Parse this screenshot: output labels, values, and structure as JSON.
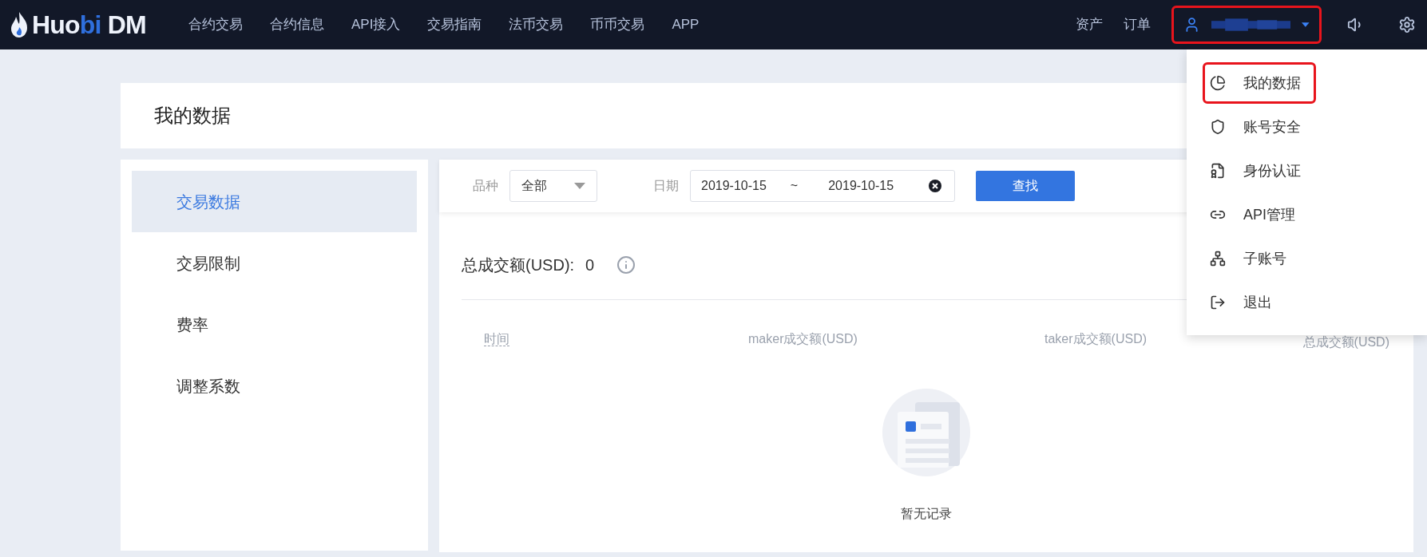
{
  "nav": {
    "logo": [
      {
        "text": "Huo",
        "accent": false
      },
      {
        "text": "bi",
        "accent": true
      },
      {
        "text": " DM",
        "accent": false
      }
    ],
    "links": [
      "合约交易",
      "合约信息",
      "API接入",
      "交易指南",
      "法币交易",
      "币币交易",
      "APP"
    ],
    "right_links": [
      "资产",
      "订单"
    ],
    "user": {
      "highlighted": true
    }
  },
  "page_title": "我的数据",
  "sidebar": {
    "items": [
      {
        "label": "交易数据",
        "selected": true
      },
      {
        "label": "交易限制",
        "selected": false
      },
      {
        "label": "费率",
        "selected": false
      },
      {
        "label": "调整系数",
        "selected": false
      }
    ]
  },
  "filters": {
    "variety_label": "品种",
    "variety_value": "全部",
    "date_label": "日期",
    "date_from": "2019-10-15",
    "date_sep": "~",
    "date_to": "2019-10-15",
    "search_button": "查找"
  },
  "summary": {
    "label": "总成交额(USD):",
    "value": "0"
  },
  "table": {
    "columns": [
      "时间",
      "maker成交额(USD)",
      "taker成交额(USD)",
      "总成交额(USD)"
    ],
    "empty_text": "暂无记录"
  },
  "user_menu": {
    "items": [
      {
        "label": "我的数据",
        "highlighted": true
      },
      {
        "label": "账号安全",
        "highlighted": false
      },
      {
        "label": "身份认证",
        "highlighted": false
      },
      {
        "label": "API管理",
        "highlighted": false
      },
      {
        "label": "子账号",
        "highlighted": false
      },
      {
        "label": "退出",
        "highlighted": false
      }
    ]
  }
}
